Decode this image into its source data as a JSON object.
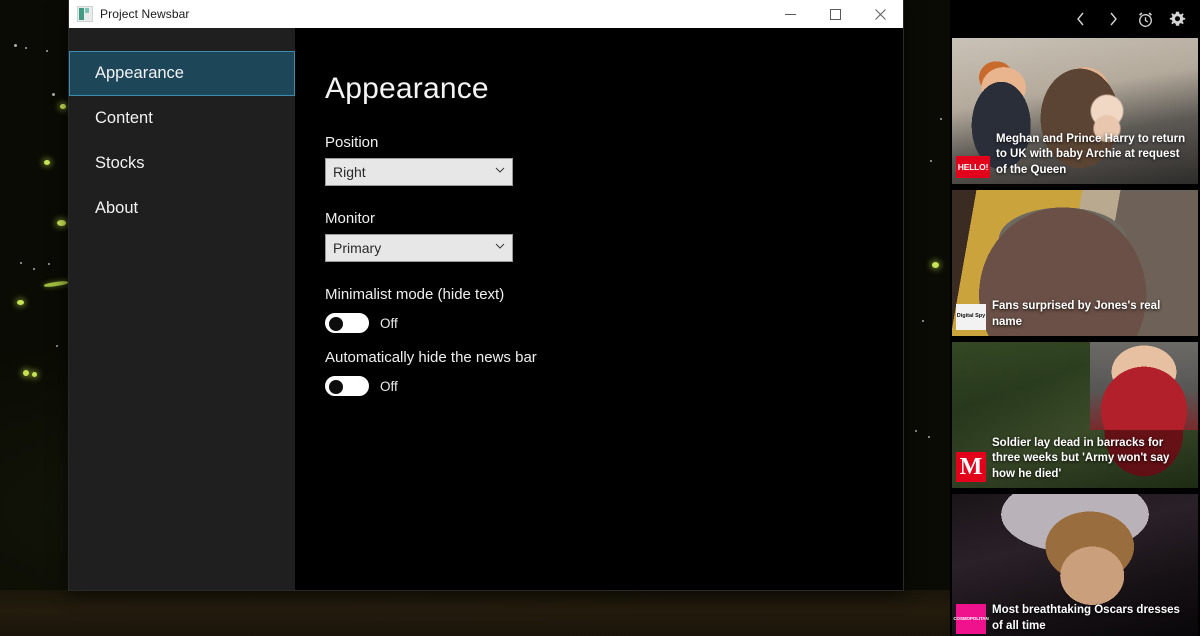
{
  "window": {
    "title": "Project Newsbar",
    "icon": "app-icon",
    "controls": {
      "minimize": "minimize-icon",
      "maximize": "maximize-icon",
      "close": "close-icon"
    }
  },
  "sidebar": {
    "items": [
      {
        "label": "Appearance",
        "selected": true
      },
      {
        "label": "Content",
        "selected": false
      },
      {
        "label": "Stocks",
        "selected": false
      },
      {
        "label": "About",
        "selected": false
      }
    ]
  },
  "main": {
    "page_title": "Appearance",
    "position": {
      "label": "Position",
      "value": "Right",
      "chevron": "chevron-down-icon",
      "options": [
        "Right"
      ]
    },
    "monitor": {
      "label": "Monitor",
      "value": "Primary",
      "chevron": "chevron-down-icon",
      "options": [
        "Primary"
      ]
    },
    "minimalist_mode": {
      "label": "Minimalist mode  (hide text)",
      "state": "Off"
    },
    "auto_hide": {
      "label": "Automatically hide the news bar",
      "state": "Off"
    }
  },
  "newsbar": {
    "toolbar": [
      {
        "name": "previous-icon",
        "glyph": "‹"
      },
      {
        "name": "next-icon",
        "glyph": "›"
      },
      {
        "name": "alarm-clock-icon",
        "glyph": "⏰"
      },
      {
        "name": "settings-gear-icon",
        "glyph": "⚙"
      }
    ],
    "cards": [
      {
        "headline": "Meghan and Prince Harry to return to UK with baby Archie at request of the Queen",
        "source": "HELLO!",
        "badge_class": "badge-hello",
        "thumb_class": "thumb-royal"
      },
      {
        "headline": "Fans surprised by Jones's real name",
        "source": "Digital Spy",
        "badge_class": "badge-dspy",
        "thumb_class": "thumb-awards"
      },
      {
        "headline": "Soldier lay dead in barracks for three weeks but 'Army won't say how he died'",
        "source": "M",
        "badge_class": "badge-mirror",
        "thumb_class": "thumb-barracks"
      },
      {
        "headline": "Most breathtaking Oscars dresses of all time",
        "source": "COSMOPOLITAN",
        "badge_class": "badge-cosmo",
        "thumb_class": "thumb-oscars"
      }
    ]
  },
  "colors": {
    "selected_nav_fill": "#1d4759",
    "selected_nav_border": "#3d8cb0",
    "sidebar_bg": "#1f1f1f",
    "content_bg": "#000000",
    "titlebar_bg": "#ffffff",
    "dropdown_bg": "#e7e7e7"
  }
}
